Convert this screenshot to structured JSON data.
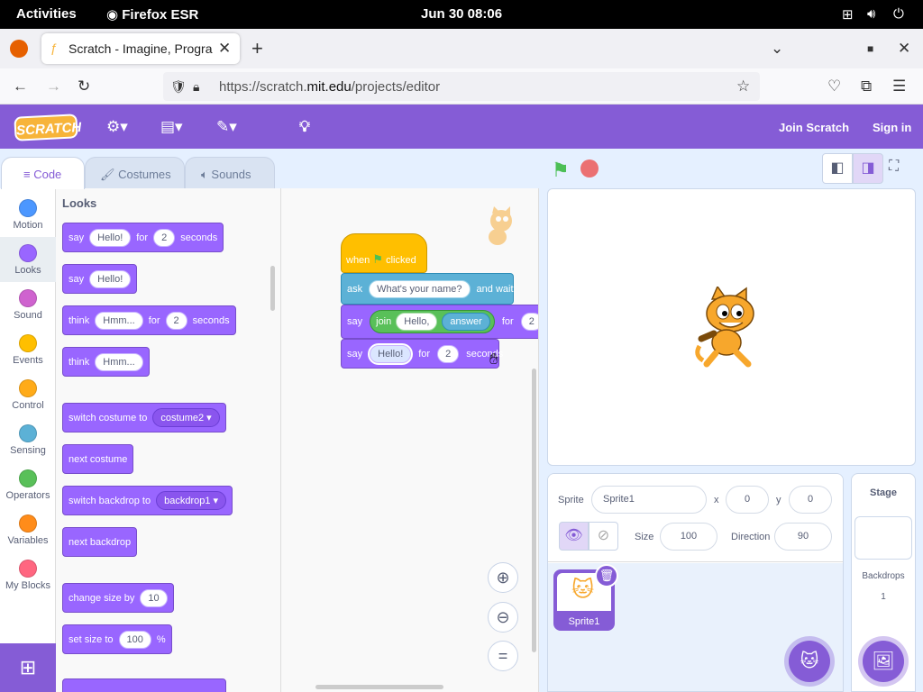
{
  "system": {
    "activities": "Activities",
    "app": "Firefox ESR",
    "datetime": "Jun 30  08:06"
  },
  "browser": {
    "tab_title": "Scratch - Imagine, Progra",
    "url_prefix": "https://scratch.",
    "url_domain": "mit.edu",
    "url_path": "/projects/editor"
  },
  "menu": {
    "logo": "SCRATCH",
    "join": "Join Scratch",
    "signin": "Sign in"
  },
  "tabs": {
    "code": "Code",
    "costumes": "Costumes",
    "sounds": "Sounds"
  },
  "categories": [
    {
      "label": "Motion",
      "color": "#4c97ff"
    },
    {
      "label": "Looks",
      "color": "#9966ff"
    },
    {
      "label": "Sound",
      "color": "#cf63cf"
    },
    {
      "label": "Events",
      "color": "#ffbf00"
    },
    {
      "label": "Control",
      "color": "#ffab19"
    },
    {
      "label": "Sensing",
      "color": "#5cb1d6"
    },
    {
      "label": "Operators",
      "color": "#59c059"
    },
    {
      "label": "Variables",
      "color": "#ff8c1a"
    },
    {
      "label": "My Blocks",
      "color": "#ff6680"
    }
  ],
  "palette": {
    "title": "Looks",
    "say_for": {
      "say": "say",
      "msg": "Hello!",
      "for": "for",
      "secs": "2",
      "seconds": "seconds"
    },
    "say": {
      "say": "say",
      "msg": "Hello!"
    },
    "think_for": {
      "think": "think",
      "msg": "Hmm...",
      "for": "for",
      "secs": "2",
      "seconds": "seconds"
    },
    "think": {
      "think": "think",
      "msg": "Hmm..."
    },
    "switch_costume": {
      "label": "switch costume to",
      "value": "costume2"
    },
    "next_costume": "next costume",
    "switch_backdrop": {
      "label": "switch backdrop to",
      "value": "backdrop1"
    },
    "next_backdrop": "next backdrop",
    "change_size": {
      "label": "change size by",
      "value": "10"
    },
    "set_size": {
      "label": "set size to",
      "value": "100",
      "unit": "%"
    }
  },
  "script": {
    "when": "when",
    "clicked": "clicked",
    "ask": "ask",
    "ask_q": "What's your name?",
    "and_wait": "and wait",
    "say1": "say",
    "join": "join",
    "join_a": "Hello,",
    "answer": "answer",
    "for1": "for",
    "secs1": "2",
    "say2": "say",
    "say2_msg": "Hello!",
    "for2": "for",
    "secs2": "2",
    "seconds2": "seconds"
  },
  "sprite": {
    "label_sprite": "Sprite",
    "name": "Sprite1",
    "label_x": "x",
    "x": "0",
    "label_y": "y",
    "y": "0",
    "label_size": "Size",
    "size": "100",
    "label_direction": "Direction",
    "direction": "90",
    "thumb_name": "Sprite1"
  },
  "stage_panel": {
    "title": "Stage",
    "backdrops_label": "Backdrops",
    "backdrops_count": "1"
  }
}
